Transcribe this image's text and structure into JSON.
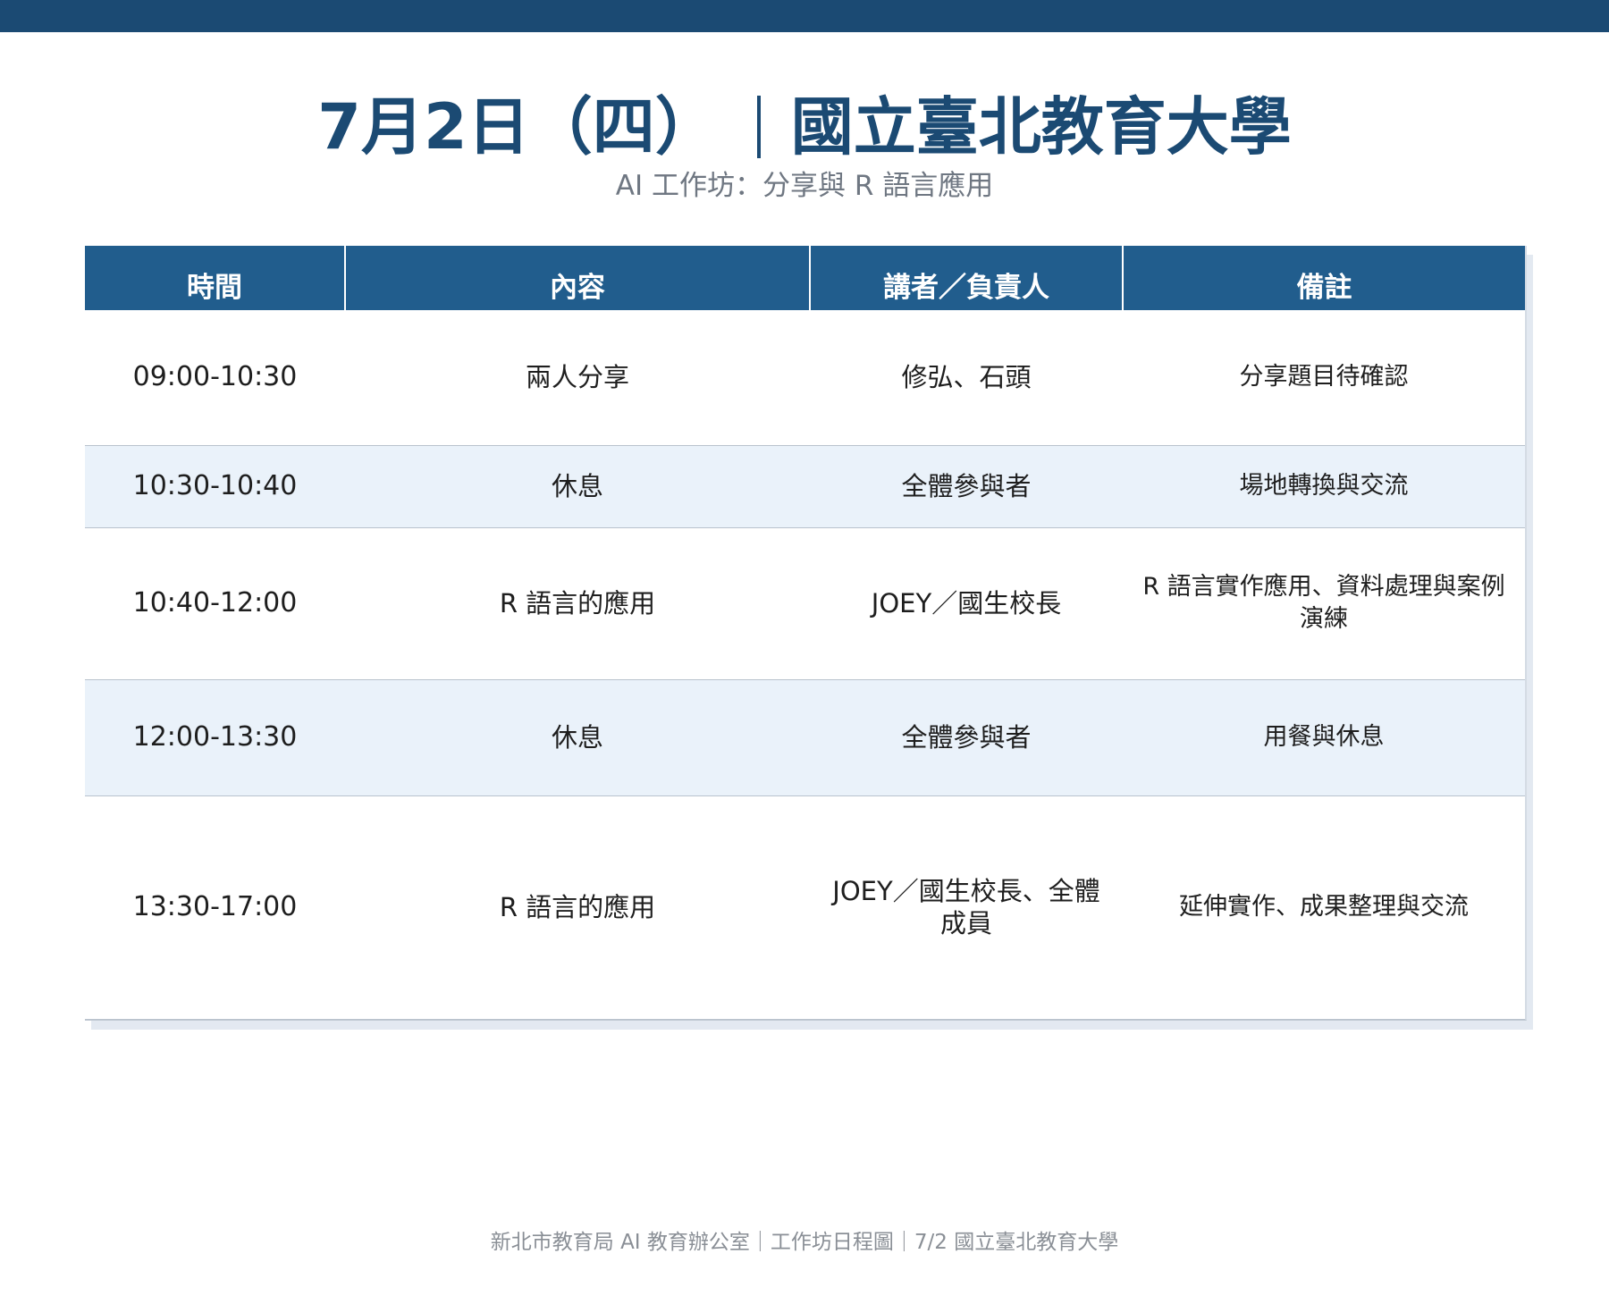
{
  "header": {
    "date": "7月2日（四）",
    "venue": "國立臺北教育大學",
    "subtitle": "AI 工作坊：分享與 R 語言應用"
  },
  "table": {
    "columns": [
      "時間",
      "內容",
      "講者／負責人",
      "備註"
    ],
    "rows": [
      {
        "time": "09:00-10:30",
        "content": "兩人分享",
        "speaker": "修弘、石頭",
        "note": "分享題目待確認"
      },
      {
        "time": "10:30-10:40",
        "content": "休息",
        "speaker": "全體參與者",
        "note": "場地轉換與交流"
      },
      {
        "time": "10:40-12:00",
        "content": "R 語言的應用",
        "speaker": "JOEY／國生校長",
        "note": "R 語言實作應用、資料處理與案例演練"
      },
      {
        "time": "12:00-13:30",
        "content": "休息",
        "speaker": "全體參與者",
        "note": "用餐與休息"
      },
      {
        "time": "13:30-17:00",
        "content": "R 語言的應用",
        "speaker": "JOEY／國生校長、全體成員",
        "note": "延伸實作、成果整理與交流"
      }
    ]
  },
  "footer": {
    "text": "新北市教育局 AI 教育辦公室｜工作坊日程圖｜7/2 國立臺北教育大學"
  }
}
